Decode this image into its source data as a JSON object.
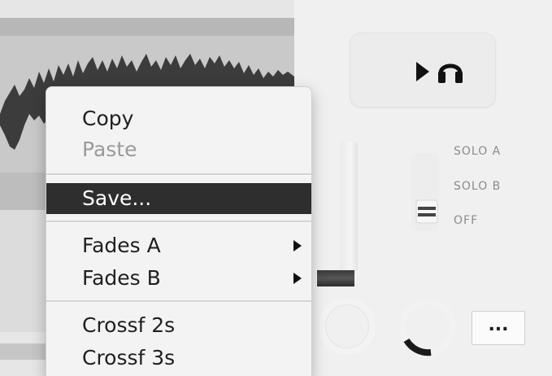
{
  "context_menu": {
    "items": [
      {
        "label": "Copy",
        "state": "enabled"
      },
      {
        "label": "Paste",
        "state": "disabled"
      },
      {
        "label": "Save...",
        "state": "selected"
      },
      {
        "label": "Fades A",
        "state": "enabled",
        "submenu": true
      },
      {
        "label": "Fades B",
        "state": "enabled",
        "submenu": true
      },
      {
        "label": "Crossf 2s",
        "state": "enabled"
      },
      {
        "label": "Crossf 3s",
        "state": "enabled"
      }
    ]
  },
  "transport": {
    "play_icon": "play-icon",
    "headphones_icon": "headphones-icon"
  },
  "solo_switch": {
    "options": [
      "SOLO A",
      "SOLO B",
      "OFF"
    ],
    "selected": "OFF"
  },
  "more_button": {
    "label": "..."
  },
  "colors": {
    "menu_highlight": "#2e2e2e",
    "waveform": "#3c3c3c",
    "label_gray": "#8b8b8b"
  }
}
